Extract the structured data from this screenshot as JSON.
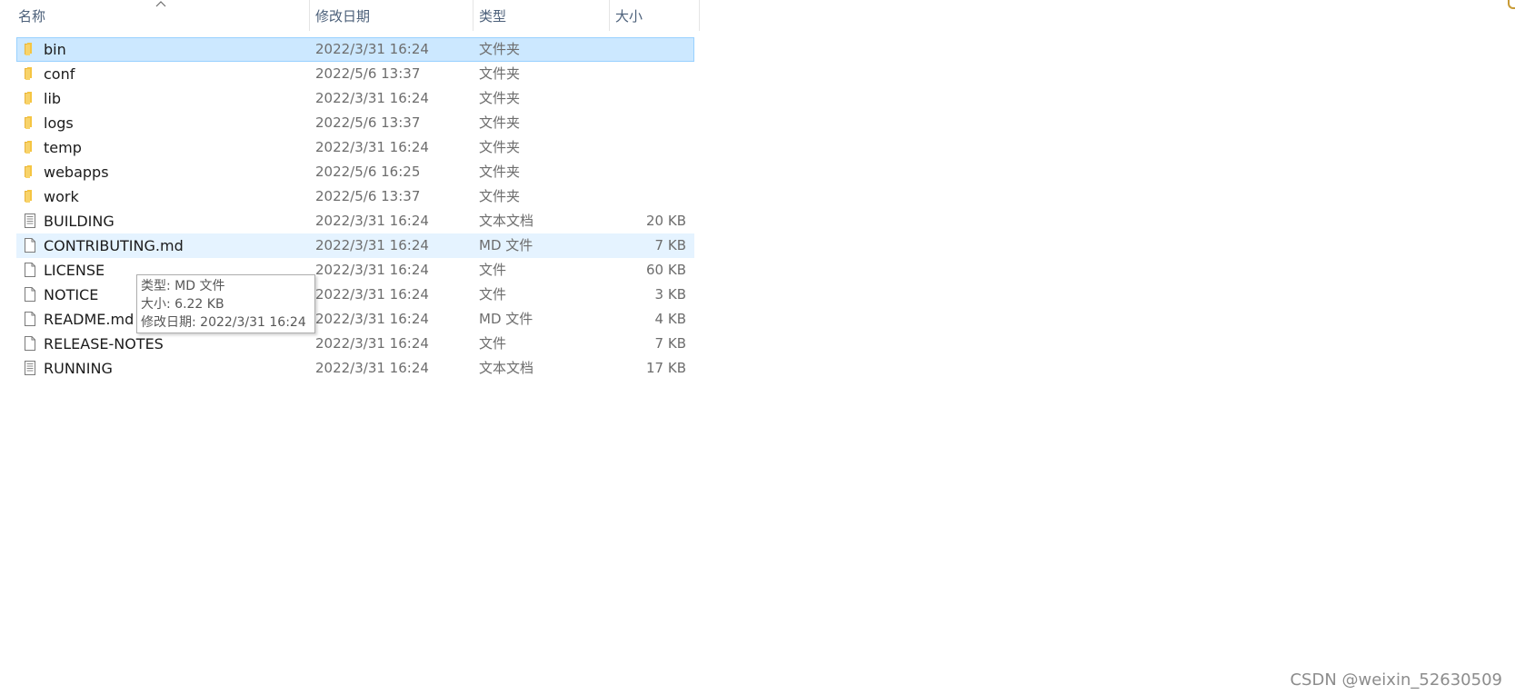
{
  "columns": {
    "name": "名称",
    "modified": "修改日期",
    "type": "类型",
    "size": "大小"
  },
  "files": [
    {
      "name": "bin",
      "date": "2022/3/31 16:24",
      "type": "文件夹",
      "size": "",
      "icon": "folder-icon",
      "state": "selected"
    },
    {
      "name": "conf",
      "date": "2022/5/6 13:37",
      "type": "文件夹",
      "size": "",
      "icon": "folder-icon",
      "state": ""
    },
    {
      "name": "lib",
      "date": "2022/3/31 16:24",
      "type": "文件夹",
      "size": "",
      "icon": "folder-icon",
      "state": ""
    },
    {
      "name": "logs",
      "date": "2022/5/6 13:37",
      "type": "文件夹",
      "size": "",
      "icon": "folder-icon",
      "state": ""
    },
    {
      "name": "temp",
      "date": "2022/3/31 16:24",
      "type": "文件夹",
      "size": "",
      "icon": "folder-icon",
      "state": ""
    },
    {
      "name": "webapps",
      "date": "2022/5/6 16:25",
      "type": "文件夹",
      "size": "",
      "icon": "folder-icon",
      "state": ""
    },
    {
      "name": "work",
      "date": "2022/5/6 13:37",
      "type": "文件夹",
      "size": "",
      "icon": "folder-icon",
      "state": ""
    },
    {
      "name": "BUILDING",
      "date": "2022/3/31 16:24",
      "type": "文本文档",
      "size": "20 KB",
      "icon": "text-document-icon",
      "state": ""
    },
    {
      "name": "CONTRIBUTING.md",
      "date": "2022/3/31 16:24",
      "type": "MD 文件",
      "size": "7 KB",
      "icon": "file-icon",
      "state": "hover"
    },
    {
      "name": "LICENSE",
      "date": "2022/3/31 16:24",
      "type": "文件",
      "size": "60 KB",
      "icon": "file-icon",
      "state": ""
    },
    {
      "name": "NOTICE",
      "date": "2022/3/31 16:24",
      "type": "文件",
      "size": "3 KB",
      "icon": "file-icon",
      "state": ""
    },
    {
      "name": "README.md",
      "date": "2022/3/31 16:24",
      "type": "MD 文件",
      "size": "4 KB",
      "icon": "file-icon",
      "state": ""
    },
    {
      "name": "RELEASE-NOTES",
      "date": "2022/3/31 16:24",
      "type": "文件",
      "size": "7 KB",
      "icon": "file-icon",
      "state": ""
    },
    {
      "name": "RUNNING",
      "date": "2022/3/31 16:24",
      "type": "文本文档",
      "size": "17 KB",
      "icon": "text-document-icon",
      "state": ""
    }
  ],
  "tooltip": {
    "type_line": "类型: MD 文件",
    "size_line": "大小: 6.22 KB",
    "date_line": "修改日期: 2022/3/31 16:24"
  },
  "watermark": "CSDN @weixin_52630509",
  "colors": {
    "selected_bg": "#cce8ff",
    "selected_border": "#99d1ff",
    "hover_bg": "#e5f3ff",
    "header_text": "#4c607a",
    "folder": "#f5c542"
  }
}
